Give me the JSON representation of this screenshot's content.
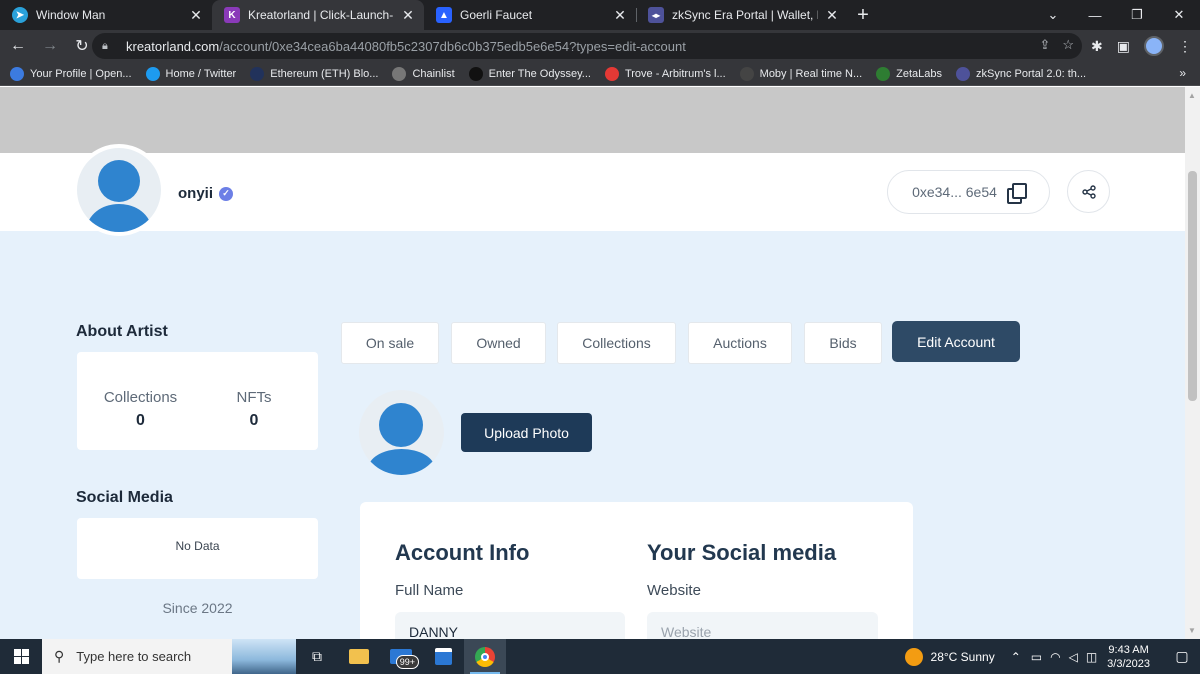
{
  "browser": {
    "tabs": [
      {
        "title": "Window Man",
        "favicon_color": "#2aa1da",
        "favicon_glyph": "➤"
      },
      {
        "title": "Kreatorland | Click-Launch-Mint NFTs",
        "favicon_color": "#8a3ab9",
        "favicon_glyph": "K",
        "active": true
      },
      {
        "title": "Goerli Faucet",
        "favicon_color": "#2962ff",
        "favicon_glyph": "▲"
      },
      {
        "title": "zkSync Era Portal | Wallet, Bridge",
        "favicon_color": "#4e529a",
        "favicon_glyph": "◂▸"
      }
    ],
    "url_host": "kreatorland.com",
    "url_path": "/account/0xe34cea6ba44080fb5c2307db6c0b375edb5e6e54?types=edit-account",
    "bookmarks": [
      {
        "label": "Your Profile | Open...",
        "color": "#3c7be0"
      },
      {
        "label": "Home / Twitter",
        "color": "#1d9bf0"
      },
      {
        "label": "Ethereum (ETH) Blo...",
        "color": "#21325b"
      },
      {
        "label": "Chainlist",
        "color": "#555555"
      },
      {
        "label": "Enter The Odyssey...",
        "color": "#222222"
      },
      {
        "label": "Trove - Arbitrum's l...",
        "color": "#e53935"
      },
      {
        "label": "Moby | Real time N...",
        "color": "#444444"
      },
      {
        "label": "ZetaLabs",
        "color": "#2e7d32"
      },
      {
        "label": "zkSync Portal 2.0: th...",
        "color": "#4e529a"
      }
    ]
  },
  "profile": {
    "name": "onyii",
    "address": "0xe34... 6e54"
  },
  "sidebar": {
    "about_heading": "About Artist",
    "collections_label": "Collections",
    "collections_count": "0",
    "nfts_label": "NFTs",
    "nfts_count": "0",
    "social_heading": "Social Media",
    "social_empty": "No Data",
    "since": "Since 2022"
  },
  "tabs": [
    "On sale",
    "Owned",
    "Collections",
    "Auctions",
    "Bids"
  ],
  "edit_account_label": "Edit Account",
  "upload_photo_label": "Upload Photo",
  "form": {
    "account_info_title": "Account Info",
    "social_title": "Your Social media",
    "full_name_label": "Full Name",
    "full_name_value": "DANNY",
    "website_label": "Website",
    "website_placeholder": "Website"
  },
  "taskbar": {
    "search_placeholder": "Type here to search",
    "mail_badge": "99+",
    "weather": "28°C  Sunny",
    "time": "9:43 AM",
    "date": "3/3/2023"
  }
}
